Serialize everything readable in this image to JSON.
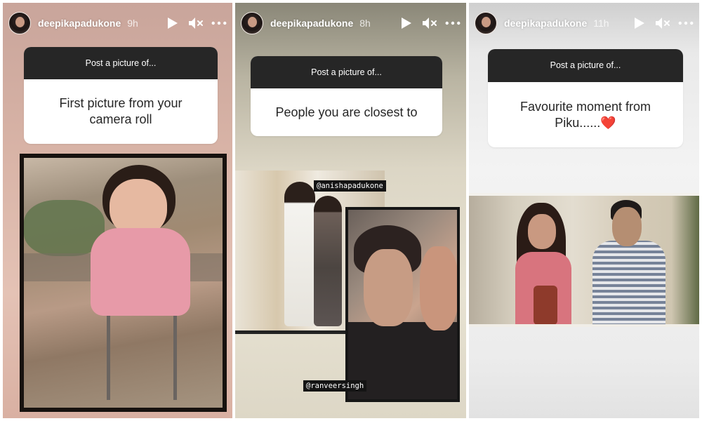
{
  "stories": [
    {
      "username": "deepikapadukone",
      "time": "9h",
      "prompt_label": "Post a picture of...",
      "prompt_text": "First picture from your camera roll"
    },
    {
      "username": "deepikapadukone",
      "time": "8h",
      "prompt_label": "Post a picture of...",
      "prompt_text": "People you are closest to",
      "tags": [
        "@anishapadukone",
        "@ranveersingh"
      ]
    },
    {
      "username": "deepikapadukone",
      "time": "11h",
      "prompt_label": "Post a picture of...",
      "prompt_text": "Favourite moment from Piku......",
      "prompt_emoji": "❤️"
    }
  ],
  "icons": {
    "play": "play-icon",
    "mute": "mute-icon",
    "more": "more-icon"
  },
  "colors": {
    "prompt_header_bg": "#262626",
    "prompt_body_bg": "#ffffff",
    "text_dark": "#262626",
    "heart": "#e0262b"
  }
}
